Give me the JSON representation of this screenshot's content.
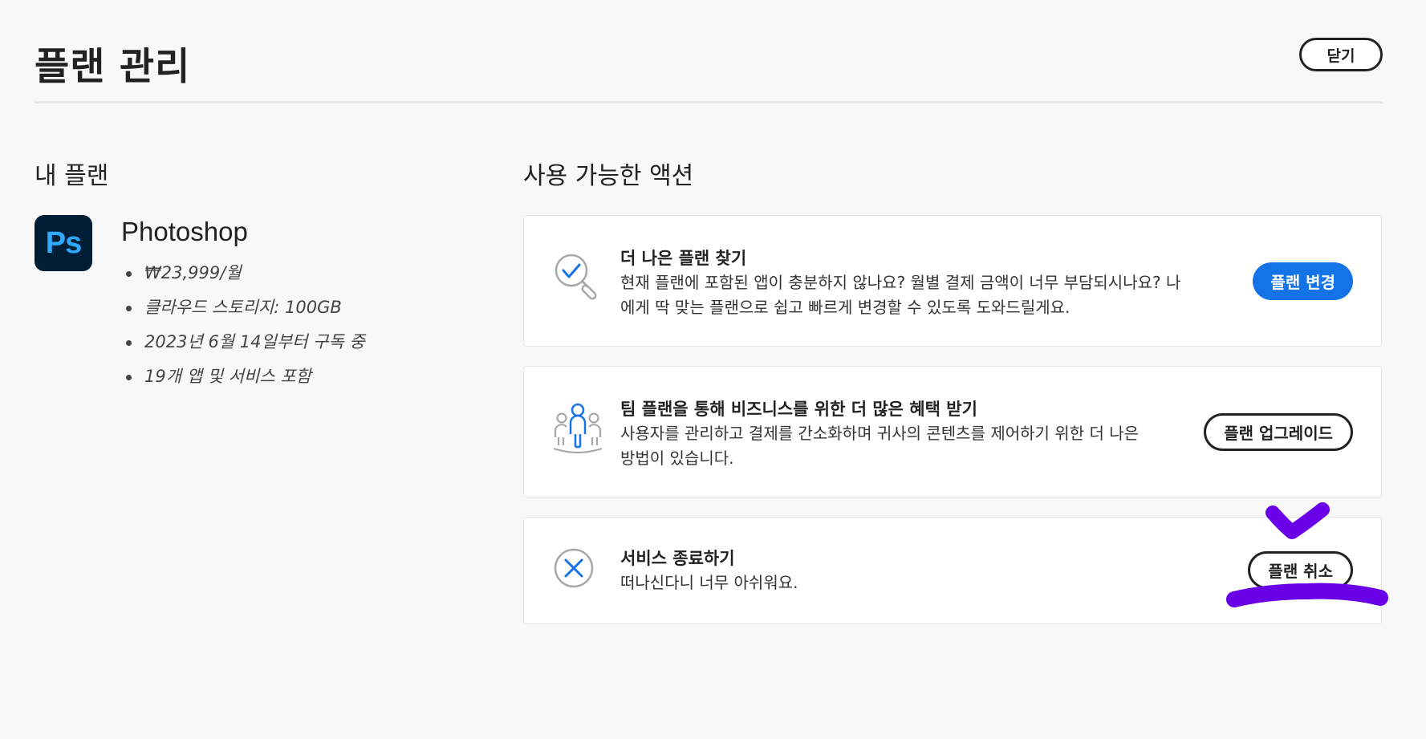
{
  "header": {
    "title": "플랜 관리",
    "close_label": "닫기"
  },
  "my_plan": {
    "heading": "내 플랜",
    "product": {
      "logo_text": "Ps",
      "name": "Photoshop",
      "details": [
        "₩23,999/월",
        "클라우드 스토리지: 100GB",
        "2023년 6월 14일부터 구독 중",
        "19개 앱 및 서비스 포함"
      ]
    }
  },
  "actions": {
    "heading": "사용 가능한 액션",
    "cards": [
      {
        "icon": "magnifier-check-icon",
        "title": "더 나은 플랜 찾기",
        "description_lines": [
          "현재 플랜에 포함된 앱이 충분하지 않나요? 월별 결제 금액이 너무 부담되시나요? 나",
          "에게 딱 맞는 플랜으로 쉽고 빠르게 변경할 수 있도록 도와드릴게요."
        ],
        "button_label": "플랜 변경"
      },
      {
        "icon": "team-icon",
        "title": "팀 플랜을 통해 비즈니스를 위한 더 많은 혜택 받기",
        "description_lines": [
          "사용자를 관리하고 결제를 간소화하며 귀사의 콘텐츠를 제어하기 위한 더 나은",
          "방법이 있습니다."
        ],
        "button_label": "플랜 업그레이드"
      },
      {
        "icon": "close-circle-icon",
        "title": "서비스 종료하기",
        "description_lines": [
          "떠나신다니 너무 아쉬워요."
        ],
        "button_label": "플랜 취소"
      }
    ]
  },
  "colors": {
    "accent_blue": "#1473e6",
    "annotation_purple": "#6a00e8",
    "ps_logo_bg": "#001e36",
    "ps_logo_text": "#31a8ff"
  }
}
